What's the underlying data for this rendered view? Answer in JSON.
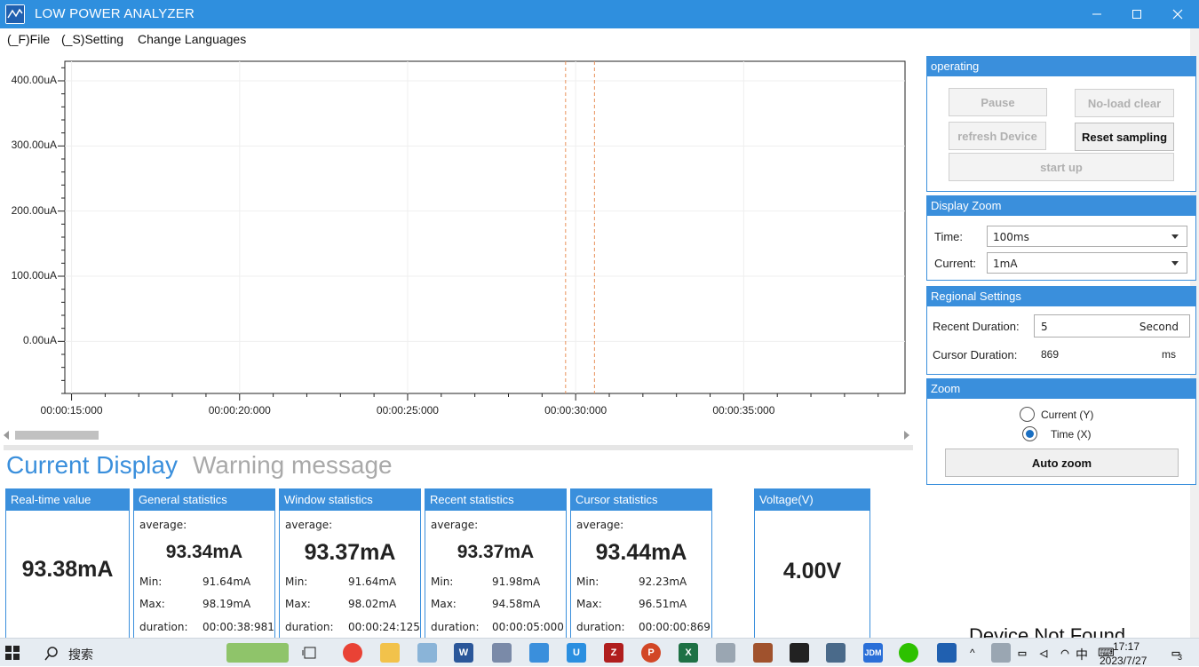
{
  "window": {
    "title": "LOW POWER ANALYZER"
  },
  "menu": [
    "(_F)File",
    "(_S)Setting",
    "Change Languages"
  ],
  "chart_data": {
    "type": "line",
    "y_ticks": [
      "400.00uA",
      "300.00uA",
      "200.00uA",
      "100.00uA",
      "0.00uA"
    ],
    "y_tick_values": [
      400,
      300,
      200,
      100,
      0
    ],
    "ylim": [
      -80,
      430
    ],
    "x_ticks": [
      "00:00:15:000",
      "00:00:20:000",
      "00:00:25:000",
      "00:00:30:000",
      "00:00:35:000"
    ],
    "x_tick_values_s": [
      15,
      20,
      25,
      30,
      35
    ],
    "xlim_s": [
      14.8,
      39.8
    ],
    "cursors_s": [
      29.7,
      30.56
    ],
    "cursor_color": "#e8915a",
    "grid": true,
    "series": []
  },
  "display_tabs": {
    "current": "Current Display",
    "warning": "Warning message"
  },
  "cards": {
    "realtime": {
      "title": "Real-time value",
      "value": "93.38mA"
    },
    "general": {
      "title": "General statistics",
      "avg_label": "average:",
      "avg": "93.34mA",
      "min_label": "Min:",
      "min": "91.64mA",
      "max_label": "Max:",
      "max": "98.19mA",
      "dur_label": "duration:",
      "dur": "00:00:38:981"
    },
    "window": {
      "title": "Window statistics",
      "avg_label": "average:",
      "avg": "93.37mA",
      "min_label": "Min:",
      "min": "91.64mA",
      "max_label": "Max:",
      "max": "98.02mA",
      "dur_label": "duration:",
      "dur": "00:00:24:125"
    },
    "recent": {
      "title": "Recent statistics",
      "avg_label": "average:",
      "avg": "93.37mA",
      "min_label": "Min:",
      "min": "91.98mA",
      "max_label": "Max:",
      "max": "94.58mA",
      "dur_label": "duration:",
      "dur": "00:00:05:000"
    },
    "cursor": {
      "title": "Cursor statistics",
      "avg_label": "average:",
      "avg": "93.44mA",
      "min_label": "Min:",
      "min": "92.23mA",
      "max_label": "Max:",
      "max": "96.51mA",
      "dur_label": "duration:",
      "dur": "00:00:00:869"
    },
    "voltage": {
      "title": "Voltage(V)",
      "value": "4.00V"
    }
  },
  "operating": {
    "title": "operating",
    "pause": "Pause",
    "noload_clear": "No-load clear",
    "refresh_device": "refresh Device",
    "reset_sampling": "Reset sampling",
    "start_up": "start up"
  },
  "display_zoom": {
    "title": "Display Zoom",
    "time_label": "Time:",
    "time_value": "100ms",
    "current_label": "Current:",
    "current_value": "1mA"
  },
  "regional": {
    "title": "Regional Settings",
    "recent_label": "Recent Duration:",
    "recent_value": "5",
    "recent_unit": "Second",
    "cursor_label": "Cursor Duration:",
    "cursor_value": "869",
    "cursor_unit": "ms"
  },
  "zoom": {
    "title": "Zoom",
    "current_option": "Current (Y)",
    "time_option": "Time (X)",
    "selected": "time",
    "auto_zoom": "Auto zoom"
  },
  "status": "Device Not Found",
  "taskbar": {
    "search": "搜索",
    "ime": "中",
    "time": "17:17",
    "date": "2023/7/27",
    "notifications": "3"
  }
}
